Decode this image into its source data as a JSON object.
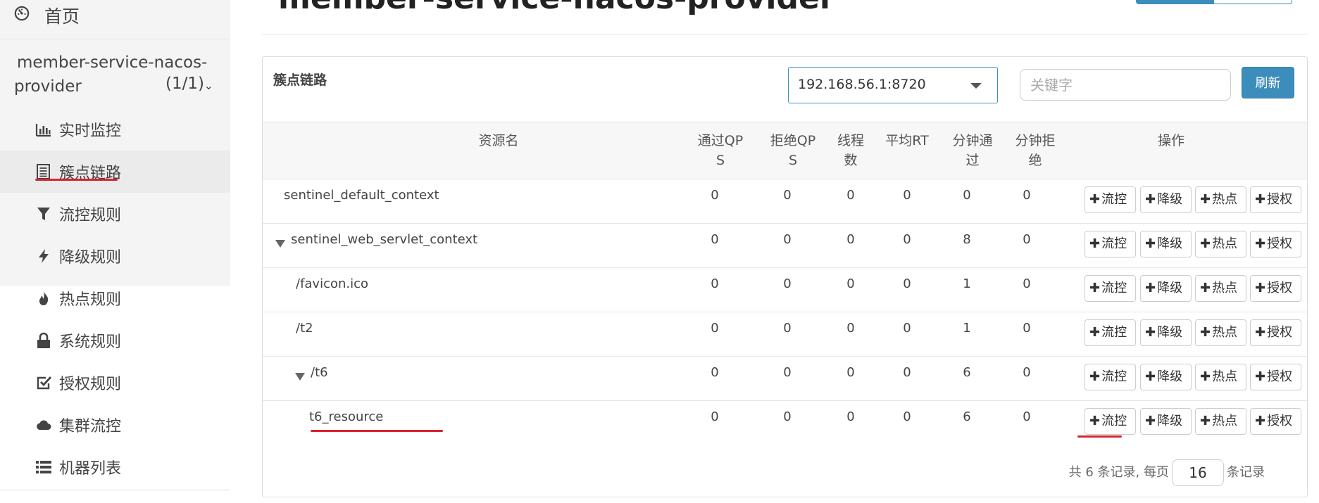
{
  "page_title": "member-service-nacos-provider",
  "sidebar": {
    "home_label": "首页",
    "app_name_line1": "member-service-nacos-",
    "app_name_line2": "provider",
    "app_count": "(1/1)",
    "items": [
      {
        "label": "实时监控",
        "icon": "bar-chart-icon"
      },
      {
        "label": "簇点链路",
        "icon": "list-icon",
        "active": true
      },
      {
        "label": "流控规则",
        "icon": "filter-icon"
      },
      {
        "label": "降级规则",
        "icon": "flash-icon"
      },
      {
        "label": "热点规则",
        "icon": "fire-icon"
      },
      {
        "label": "系统规则",
        "icon": "lock-icon"
      },
      {
        "label": "授权规则",
        "icon": "check-square-icon"
      },
      {
        "label": "集群流控",
        "icon": "cloud-icon"
      },
      {
        "label": "机器列表",
        "icon": "list-ul-icon"
      }
    ]
  },
  "panel": {
    "title": "簇点链路",
    "machine_select": "192.168.56.1:8720",
    "keyword_placeholder": "关键字",
    "refresh_label": "刷新"
  },
  "table": {
    "headers": {
      "name": "资源名",
      "pass_qps_1": "通过QP",
      "pass_qps_2": "S",
      "block_qps_1": "拒绝QP",
      "block_qps_2": "S",
      "threads_1": "线程",
      "threads_2": "数",
      "avg_rt": "平均RT",
      "min_pass_1": "分钟通",
      "min_pass_2": "过",
      "min_block_1": "分钟拒",
      "min_block_2": "绝",
      "ops": "操作"
    },
    "op_labels": [
      "流控",
      "降级",
      "热点",
      "授权"
    ],
    "rows": [
      {
        "name": "sentinel_default_context",
        "pass_qps": "0",
        "block_qps": "0",
        "threads": "0",
        "avg_rt": "0",
        "min_pass": "0",
        "min_block": "0"
      },
      {
        "name": "sentinel_web_servlet_context",
        "pass_qps": "0",
        "block_qps": "0",
        "threads": "0",
        "avg_rt": "0",
        "min_pass": "8",
        "min_block": "0"
      },
      {
        "name": "/favicon.ico",
        "pass_qps": "0",
        "block_qps": "0",
        "threads": "0",
        "avg_rt": "0",
        "min_pass": "1",
        "min_block": "0"
      },
      {
        "name": "/t2",
        "pass_qps": "0",
        "block_qps": "0",
        "threads": "0",
        "avg_rt": "0",
        "min_pass": "1",
        "min_block": "0"
      },
      {
        "name": "/t6",
        "pass_qps": "0",
        "block_qps": "0",
        "threads": "0",
        "avg_rt": "0",
        "min_pass": "6",
        "min_block": "0"
      },
      {
        "name": "t6_resource",
        "pass_qps": "0",
        "block_qps": "0",
        "threads": "0",
        "avg_rt": "0",
        "min_pass": "6",
        "min_block": "0"
      }
    ]
  },
  "footer": {
    "prefix": "共 6 条记录, 每页",
    "page_size": "16",
    "suffix": "条记录"
  },
  "colors": {
    "accent": "#3c8dbc",
    "annotation_red": "#d9232d"
  }
}
